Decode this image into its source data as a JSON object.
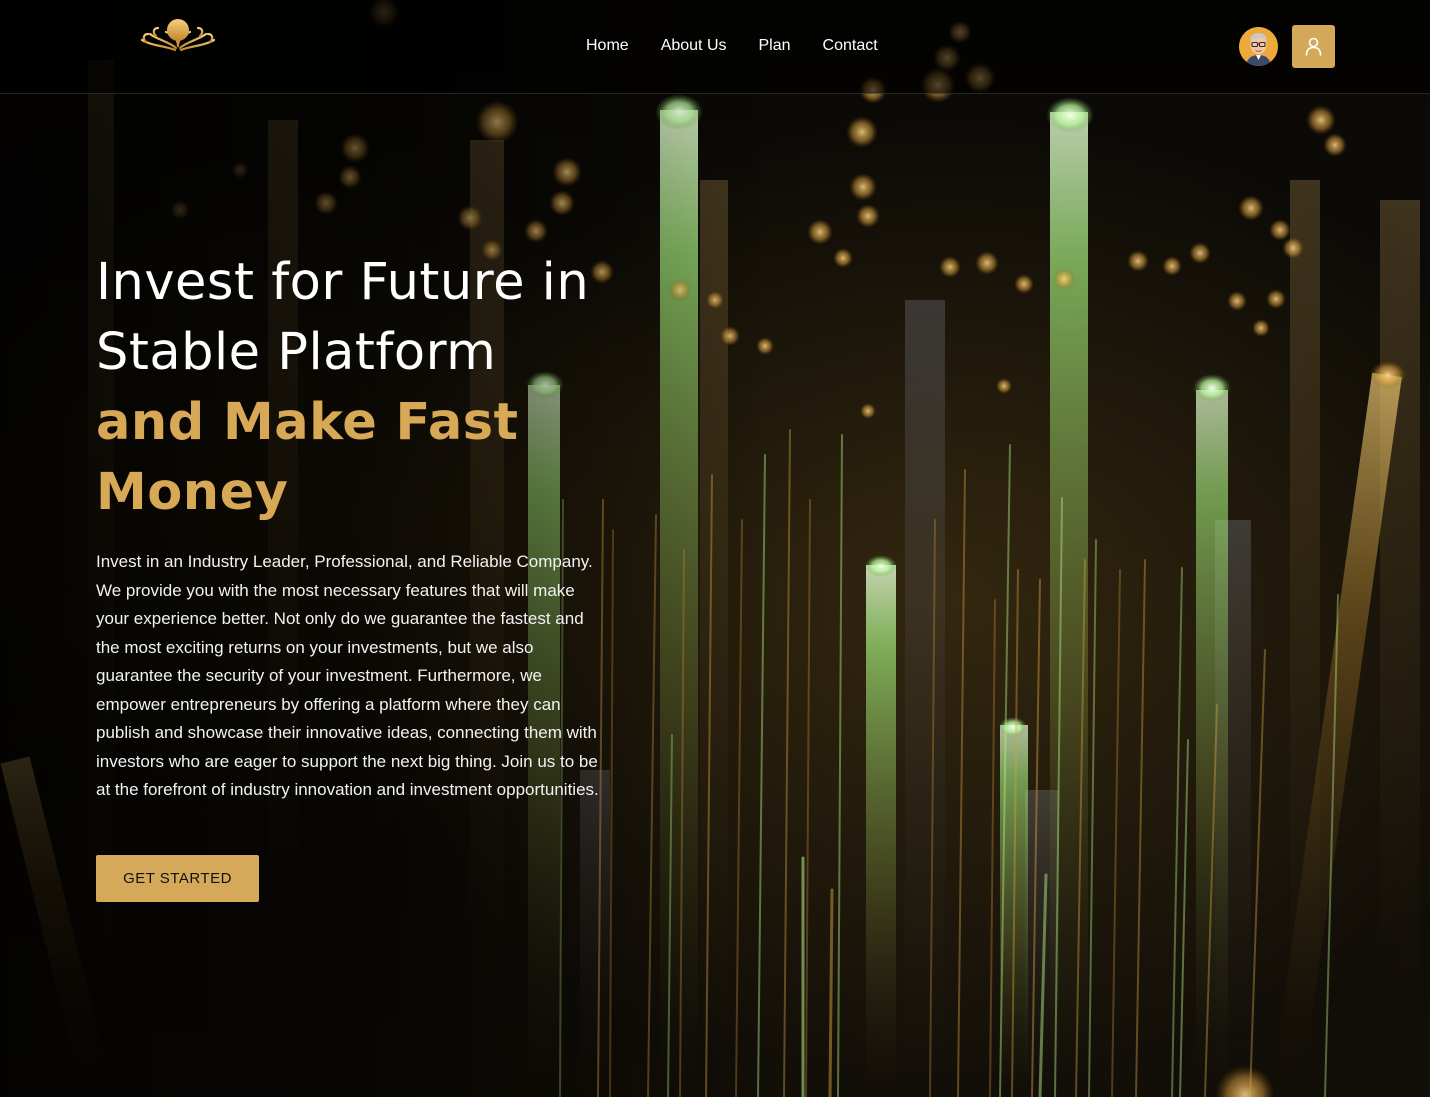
{
  "header": {
    "logo_icon": "golden-tree-logo-icon",
    "nav": [
      {
        "label": "Home"
      },
      {
        "label": "About Us"
      },
      {
        "label": "Plan"
      },
      {
        "label": "Contact"
      }
    ],
    "avatar_icon": "user-avatar-icon",
    "user_button_icon": "user-icon"
  },
  "hero": {
    "title_line1": "Invest for Future in",
    "title_line2": "Stable Platform",
    "title_line3": "and Make Fast",
    "title_line4": "Money",
    "description": "Invest in an Industry Leader, Professional, and Reliable Company. We provide you with the most necessary features that will make your experience better. Not only do we guarantee the fastest and the most exciting returns on your investments, but we also guarantee the security of your investment. Furthermore, we empower entrepreneurs by offering a platform where they can publish and showcase their innovative ideas, connecting them with investors who are eager to support the next big thing. Join us to be at the forefront of industry innovation and investment opportunities.",
    "cta_label": "GET STARTED"
  },
  "colors": {
    "accent_gold": "#d6a85a",
    "background": "#050505",
    "text": "#ffffff"
  }
}
